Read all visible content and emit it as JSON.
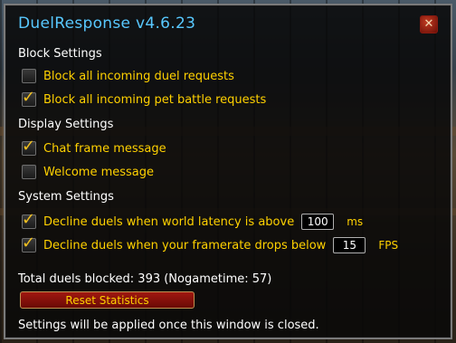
{
  "window": {
    "title": "DuelResponse v4.6.23",
    "close_icon": "close-icon"
  },
  "sections": {
    "block": {
      "heading": "Block Settings",
      "items": [
        {
          "label": "Block all incoming duel requests",
          "checked": false
        },
        {
          "label": "Block all incoming pet battle requests",
          "checked": true
        }
      ]
    },
    "display": {
      "heading": "Display Settings",
      "items": [
        {
          "label": "Chat frame message",
          "checked": true
        },
        {
          "label": "Welcome message",
          "checked": false
        }
      ]
    },
    "system": {
      "heading": "System Settings",
      "items": [
        {
          "label": "Decline duels when world latency is above",
          "checked": true,
          "value": "100",
          "unit": "ms"
        },
        {
          "label": "Decline duels when your framerate drops below",
          "checked": true,
          "value": "15",
          "unit": "FPS"
        }
      ]
    }
  },
  "stats_text": "Total duels blocked: 393 (Nogametime: 57)",
  "reset_label": "Reset Statistics",
  "footer_note": "Settings will be applied once this window is closed.",
  "colors": {
    "title": "#58c8ff",
    "label": "#ffd100",
    "reset_button": "#8a120c"
  }
}
